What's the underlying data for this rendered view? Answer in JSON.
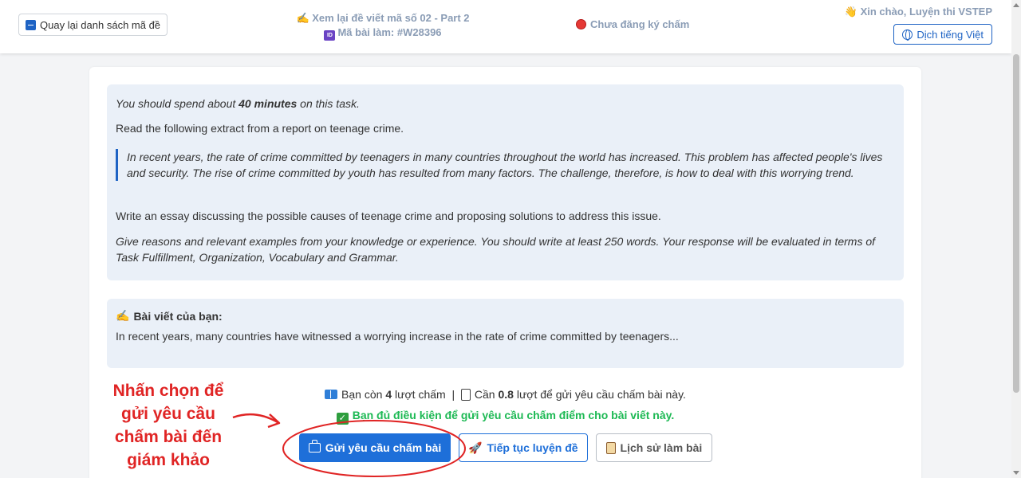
{
  "header": {
    "back_label": "Quay lại danh sách mã đề",
    "review_emoji": "✍️",
    "review_title": "Xem lại đề viết mã số 02 - Part 2",
    "id_icon_text": "ID",
    "submission_id": "Mã bài làm: #W28396",
    "status": "Chưa đăng ký chấm",
    "greet_emoji": "👋",
    "greeting": "Xin chào, Luyện thi VSTEP",
    "translate_label": "Dịch tiếng Việt"
  },
  "task": {
    "p1_pre": "You should spend about ",
    "p1_bold": "40 minutes",
    "p1_post": " on this task.",
    "p2": "Read the following extract from a report on teenage crime.",
    "quote": "In recent years, the rate of crime committed by teenagers in many countries throughout the world has increased. This problem has affected people's lives and security. The rise of crime committed by youth has resulted from many factors. The challenge, therefore, is how to deal with this worrying trend.",
    "p3": "Write an essay discussing the possible causes of teenage crime and proposing solutions to address this issue.",
    "p4": "Give reasons and relevant examples from your knowledge or experience. You should write at least 250 words. Your response will be evaluated in terms of Task Fulfillment, Organization, Vocabulary and Grammar."
  },
  "essay": {
    "emoji": "✍️",
    "title": "Bài viết của bạn:",
    "text": "In recent years, many countries have witnessed a worrying increase in the rate of crime committed by teenagers..."
  },
  "info": {
    "remaining_pre": "Bạn còn ",
    "remaining_count": "4",
    "remaining_post": " lượt chấm",
    "separator": "|",
    "need_pre": "Cần ",
    "need_count": "0.8",
    "need_post": " lượt để gửi yêu cầu chấm bài này.",
    "check_mark": "✓",
    "eligible": "Bạn đủ điều kiện để gửi yêu cầu chấm điểm cho bài viết này."
  },
  "buttons": {
    "submit": "Gửi yêu cầu chấm bài",
    "rocket_emoji": "🚀",
    "continue": "Tiếp tục luyện đề",
    "history": "Lịch sử làm bài"
  },
  "annotation": {
    "text": "Nhấn chọn để gửi yêu cầu chấm bài đến giám khảo",
    "color": "#e02424"
  },
  "colors": {
    "primary": "#1e6fd9",
    "success": "#1db954",
    "panel": "#eaf0f8"
  }
}
